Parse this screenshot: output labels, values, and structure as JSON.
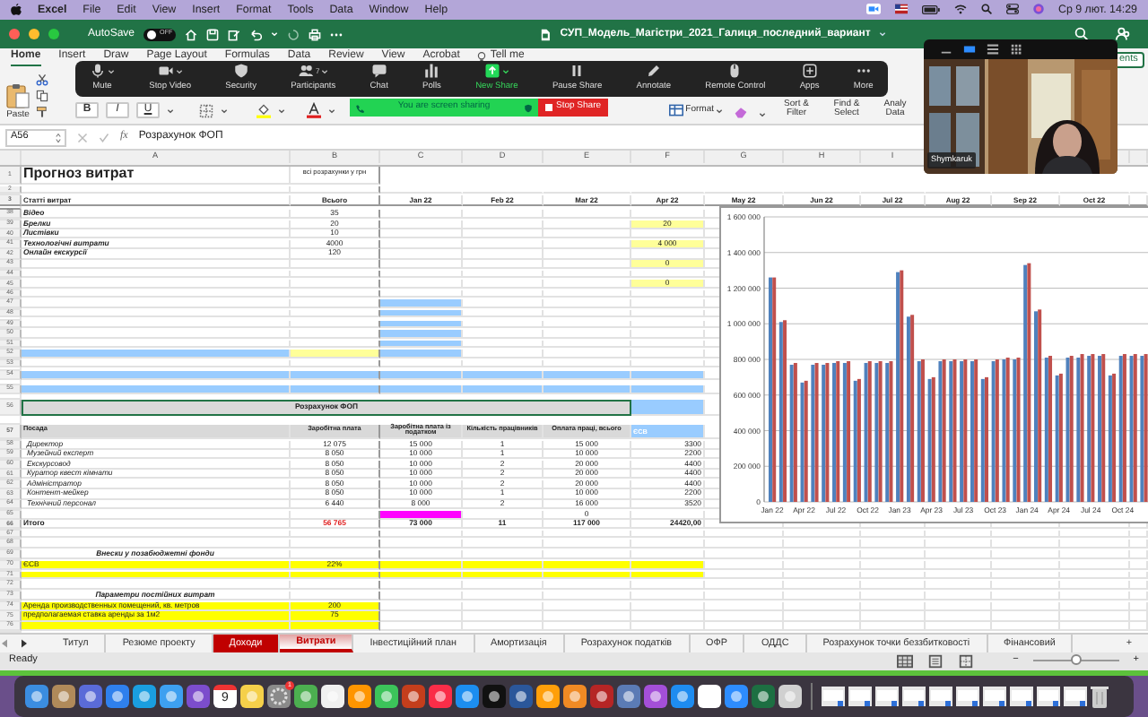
{
  "menu_bar": {
    "app": "Excel",
    "items": [
      "File",
      "Edit",
      "View",
      "Insert",
      "Format",
      "Tools",
      "Data",
      "Window",
      "Help"
    ],
    "clock": "Ср 9 лют. 14:29"
  },
  "title_bar": {
    "autosave": "AutoSave",
    "autosave_on": false,
    "toggle_label": "OFF",
    "title": "СУП_Модель_Магістри_2021_Галиця_последний_вариант"
  },
  "ribbon_tabs": [
    {
      "label": "Home",
      "selected": true
    },
    {
      "label": "Insert",
      "selected": false
    },
    {
      "label": "Draw",
      "selected": false
    },
    {
      "label": "Page Layout",
      "selected": false
    },
    {
      "label": "Formulas",
      "selected": false
    },
    {
      "label": "Data",
      "selected": false
    },
    {
      "label": "Review",
      "selected": false
    },
    {
      "label": "View",
      "selected": false
    },
    {
      "label": "Acrobat",
      "selected": false
    },
    {
      "label": "Tell me",
      "selected": false
    }
  ],
  "comments_button": "ents",
  "ribbon": {
    "paste": "Paste",
    "bold": "B",
    "italic": "I",
    "underline": "U",
    "format": "Format",
    "sort": "Sort & Filter",
    "find": "Find & Select",
    "analyze": "Analy Data"
  },
  "zoom_toolbar": [
    {
      "label": "Mute",
      "menu": true,
      "active": false
    },
    {
      "label": "Stop Video",
      "menu": true,
      "active": false
    },
    {
      "label": "Security",
      "menu": false,
      "active": false
    },
    {
      "label": "Participants",
      "count": "7",
      "menu": true,
      "active": false
    },
    {
      "label": "Chat",
      "menu": false,
      "active": false
    },
    {
      "label": "Polls",
      "menu": false,
      "active": false
    },
    {
      "label": "New Share",
      "menu": true,
      "active": true
    },
    {
      "label": "Pause Share",
      "menu": false,
      "active": false
    },
    {
      "label": "Annotate",
      "menu": false,
      "active": false
    },
    {
      "label": "Remote Control",
      "menu": false,
      "active": false
    },
    {
      "label": "Apps",
      "menu": false,
      "active": false
    },
    {
      "label": "More",
      "menu": false,
      "active": false
    }
  ],
  "share_banner": {
    "text": "You are screen sharing",
    "stop": "Stop Share"
  },
  "video": {
    "name": "Shymkaruk",
    "views": [
      {
        "selected": false
      },
      {
        "selected": true
      },
      {
        "selected": false
      },
      {
        "selected": false
      }
    ]
  },
  "formula_bar": {
    "cell": "A56",
    "fx": "fx",
    "formula": "Розрахунок ФОП"
  },
  "sheet": {
    "columns": [
      "A",
      "B",
      "C",
      "D",
      "E",
      "F",
      "G",
      "H",
      "I"
    ],
    "rows": [
      {
        "n": "1",
        "kind": "title",
        "cells": {
          "A": "Прогноз витрат",
          "B": "всі розрахунки у грн"
        }
      },
      {
        "n": "2",
        "kind": "gap"
      },
      {
        "n": "3",
        "kind": "colhead",
        "cells": {
          "A": "Статті витрат",
          "B": "Всього",
          "C": "Jan 22",
          "D": "Feb 22",
          "E": "Mar 22",
          "F": "Apr 22",
          "G": "May 22",
          "H": "Jun 22",
          "I": "Jul 22",
          "J": "Aug 22",
          "K": "Sep 22",
          "L": "Oct 22"
        }
      },
      {
        "n": "38",
        "kind": "item",
        "cells": {
          "A": "Відео",
          "B": "35"
        }
      },
      {
        "n": "39",
        "kind": "item",
        "cells": {
          "A": "Брелки",
          "B": "20",
          "F": {
            "text": "20",
            "color": "#ffff99"
          }
        }
      },
      {
        "n": "40",
        "kind": "item",
        "cells": {
          "A": "Листівки",
          "B": "10"
        }
      },
      {
        "n": "41",
        "kind": "item",
        "cells": {
          "A": "Технологічні витрати",
          "B": "4000",
          "F": {
            "text": "4 000",
            "color": "#ffff99"
          }
        }
      },
      {
        "n": "42",
        "kind": "item",
        "cells": {
          "A": "Онлайн екскурсії",
          "B": "120"
        }
      },
      {
        "n": "43",
        "kind": "item",
        "cells": {
          "F": {
            "text": "0",
            "color": "#ffff99"
          }
        }
      },
      {
        "n": "44",
        "kind": "item"
      },
      {
        "n": "45",
        "kind": "item",
        "cells": {
          "F": {
            "text": "0",
            "color": "#ffff99"
          }
        }
      },
      {
        "n": "46",
        "kind": "item"
      },
      {
        "n": "47",
        "kind": "item",
        "cells": {
          "C": {
            "color": "#99ccff"
          }
        }
      },
      {
        "n": "48",
        "kind": "item",
        "cells": {
          "C": {
            "color": "#99ccff"
          }
        }
      },
      {
        "n": "49",
        "kind": "item",
        "cells": {
          "C": {
            "color": "#99ccff"
          }
        }
      },
      {
        "n": "50",
        "kind": "item",
        "cells": {
          "C": {
            "color": "#99ccff"
          }
        }
      },
      {
        "n": "51",
        "kind": "item",
        "cells": {
          "C": {
            "color": "#99ccff"
          }
        }
      },
      {
        "n": "52",
        "kind": "item",
        "cells": {
          "A": {
            "color": "#99ccff"
          },
          "B": {
            "color": "#ffff99"
          },
          "C": {
            "color": "#99ccff"
          }
        }
      },
      {
        "n": "53",
        "kind": "item"
      },
      {
        "n": "54",
        "kind": "band",
        "cells": {
          "A": {
            "color": "#99ccff"
          },
          "B": {
            "color": "#99ccff"
          },
          "C": {
            "color": "#99ccff"
          },
          "D": {
            "color": "#99ccff"
          },
          "E": {
            "color": "#99ccff"
          },
          "F": {
            "color": "#99ccff"
          }
        }
      },
      {
        "n": "55",
        "kind": "band",
        "cells": {
          "A": {
            "color": "#99ccff"
          },
          "B": {
            "color": "#99ccff"
          },
          "C": {
            "color": "#99ccff"
          },
          "D": {
            "color": "#99ccff"
          },
          "E": {
            "color": "#99ccff"
          },
          "F": {
            "color": "#99ccff"
          }
        }
      },
      {
        "n": "56",
        "kind": "section",
        "selected": true,
        "cells": {
          "A": {
            "text": "Розрахунок ФОП",
            "color": "#d9d9d9"
          },
          "F": {
            "color": "#99ccff"
          }
        }
      },
      {
        "n": "57",
        "kind": "head",
        "cells": {
          "A": {
            "text": "Посада",
            "color": "#d9d9d9"
          },
          "B": {
            "text": "Заробітна плата",
            "color": "#d9d9d9"
          },
          "C": {
            "text": "Заробітна плата із податком",
            "color": "#d9d9d9"
          },
          "D": {
            "text": "Кількість працівників",
            "color": "#d9d9d9"
          },
          "E": {
            "text": "Оплата праці, всього",
            "color": "#d9d9d9"
          },
          "F": {
            "text": "ЄСВ",
            "color": "#99ccff"
          }
        }
      },
      {
        "n": "58",
        "kind": "staff",
        "cells": {
          "A": "Директор",
          "B": "12 075",
          "C": "15 000",
          "D": "1",
          "E": "15 000",
          "F": "3300"
        }
      },
      {
        "n": "59",
        "kind": "staff",
        "cells": {
          "A": "Музейний експерт",
          "B": "8 050",
          "C": "10 000",
          "D": "1",
          "E": "10 000",
          "F": "2200"
        }
      },
      {
        "n": "60",
        "kind": "staff",
        "cells": {
          "A": "Екскурсовод",
          "B": "8 050",
          "C": "10 000",
          "D": "2",
          "E": "20 000",
          "F": "4400"
        }
      },
      {
        "n": "61",
        "kind": "staff",
        "cells": {
          "A": "Куратор квест кімнати",
          "B": "8 050",
          "C": "10 000",
          "D": "2",
          "E": "20 000",
          "F": "4400"
        }
      },
      {
        "n": "62",
        "kind": "staff",
        "cells": {
          "A": "Адміністратор",
          "B": "8 050",
          "C": "10 000",
          "D": "2",
          "E": "20 000",
          "F": "4400"
        }
      },
      {
        "n": "63",
        "kind": "staff",
        "cells": {
          "A": "Контент-мейкер",
          "B": "8 050",
          "C": "10 000",
          "D": "1",
          "E": "10 000",
          "F": "2200"
        }
      },
      {
        "n": "64",
        "kind": "staff",
        "cells": {
          "A": "Технічний персонал",
          "B": "6 440",
          "C": "8 000",
          "D": "2",
          "E": "16 000",
          "F": "3520"
        }
      },
      {
        "n": "65",
        "kind": "staff",
        "cells": {
          "C": {
            "color": "#ff00ff"
          },
          "E": "0"
        }
      },
      {
        "n": "66",
        "kind": "total",
        "cells": {
          "A": "Итого",
          "B": {
            "text": "56 765",
            "red": true
          },
          "C": "73 000",
          "D": "11",
          "E": "117 000",
          "F": "24420,00"
        }
      },
      {
        "n": "67",
        "kind": "item"
      },
      {
        "n": "68",
        "kind": "item"
      },
      {
        "n": "69",
        "kind": "caption",
        "cells": {
          "A": "Внески у позабюджетні фонди"
        }
      },
      {
        "n": "70",
        "kind": "param",
        "cells": {
          "A": {
            "text": "ЄСВ",
            "color": "#ffff00"
          },
          "B": {
            "text": "22%",
            "color": "#ffff00"
          },
          "C": {
            "color": "#ffff00"
          },
          "D": {
            "color": "#ffff00"
          },
          "E": {
            "color": "#ffff00"
          },
          "F": {
            "color": "#ffff00"
          }
        }
      },
      {
        "n": "71",
        "kind": "param",
        "cells": {
          "A": {
            "color": "#ffff00"
          },
          "B": {
            "color": "#ffff00"
          },
          "C": {
            "color": "#ffff00"
          },
          "D": {
            "color": "#ffff00"
          },
          "E": {
            "color": "#ffff00"
          },
          "F": {
            "color": "#ffff00"
          }
        }
      },
      {
        "n": "72",
        "kind": "item"
      },
      {
        "n": "73",
        "kind": "caption",
        "cells": {
          "A": "Параметри постійних витрат"
        }
      },
      {
        "n": "74",
        "kind": "param",
        "cells": {
          "A": {
            "text": "Аренда производственных помещений, кв. метров",
            "color": "#ffff00"
          },
          "B": {
            "text": "200",
            "color": "#ffff00"
          }
        }
      },
      {
        "n": "75",
        "kind": "param",
        "cells": {
          "A": {
            "text": "предполагаемая ставка аренды за 1м2",
            "color": "#ffff00"
          },
          "B": {
            "text": "75",
            "color": "#ffff00"
          }
        }
      },
      {
        "n": "76",
        "kind": "param",
        "cells": {
          "A": {
            "color": "#ffff00"
          },
          "B": {
            "color": "#ffff00"
          }
        }
      }
    ],
    "chart_data": {
      "type": "bar",
      "grid": true,
      "categories": [
        "Jan 22",
        null,
        null,
        "Apr 22",
        null,
        null,
        "Jul 22",
        null,
        null,
        "Oct 22",
        null,
        null,
        "Jan 23",
        null,
        null,
        "Apr 23",
        null,
        null,
        "Jul 23",
        null,
        null,
        "Oct 23",
        null,
        null,
        "Jan 24",
        null,
        null,
        "Apr 24",
        null,
        null,
        "Jul 24",
        null,
        null,
        "Oct 24",
        null,
        null
      ],
      "series": [
        {
          "color": "#4f81bd",
          "values": [
            1260000,
            1010000,
            770000,
            670000,
            770000,
            770000,
            780000,
            780000,
            680000,
            780000,
            780000,
            780000,
            1290000,
            1040000,
            790000,
            690000,
            790000,
            790000,
            790000,
            790000,
            690000,
            790000,
            800000,
            800000,
            1330000,
            1070000,
            810000,
            710000,
            810000,
            810000,
            820000,
            820000,
            710000,
            820000,
            820000,
            820000
          ]
        },
        {
          "color": "#c0504d",
          "values": [
            1260000,
            1020000,
            780000,
            680000,
            780000,
            780000,
            790000,
            790000,
            690000,
            790000,
            790000,
            790000,
            1300000,
            1050000,
            800000,
            700000,
            800000,
            800000,
            800000,
            800000,
            700000,
            800000,
            810000,
            810000,
            1340000,
            1080000,
            820000,
            720000,
            820000,
            830000,
            830000,
            830000,
            720000,
            830000,
            830000,
            830000
          ]
        }
      ],
      "ylim": [
        0,
        1600000
      ],
      "yticks": [
        {
          "value": 0,
          "label": "0"
        },
        {
          "value": 200000,
          "label": "200 000"
        },
        {
          "value": 400000,
          "label": "400 000"
        },
        {
          "value": 600000,
          "label": "600 000"
        },
        {
          "value": 800000,
          "label": "800 000"
        },
        {
          "value": 1000000,
          "label": "1 000 000"
        },
        {
          "value": 1200000,
          "label": "1 200 000"
        },
        {
          "value": 1400000,
          "label": "1 400 000"
        },
        {
          "value": 1600000,
          "label": "1 600 000"
        }
      ]
    }
  },
  "sheet_tabs": [
    {
      "label": "Титул",
      "selected": false
    },
    {
      "label": "Резюме проекту",
      "selected": false
    },
    {
      "label": "Доходи",
      "selected": false,
      "color": "#c00000"
    },
    {
      "label": "Витрати",
      "selected": true,
      "color": "#c00000"
    },
    {
      "label": "Інвестиційний план",
      "selected": false
    },
    {
      "label": "Амортизація",
      "selected": false
    },
    {
      "label": "Розрахунок податків",
      "selected": false
    },
    {
      "label": "ОФР",
      "selected": false
    },
    {
      "label": "ОДДС",
      "selected": false
    },
    {
      "label": "Розрахунок точки беззбитковості",
      "selected": false
    },
    {
      "label": "Фінансовий",
      "selected": false
    }
  ],
  "add_sheet": "+",
  "status_bar": {
    "text": "Ready",
    "views": [
      {
        "selected": true
      },
      {
        "selected": false
      },
      {
        "selected": false
      }
    ],
    "minus": "−",
    "plus": "+",
    "level": 0.5
  },
  "dock": {
    "calendar_day": "9",
    "badge": "1"
  }
}
